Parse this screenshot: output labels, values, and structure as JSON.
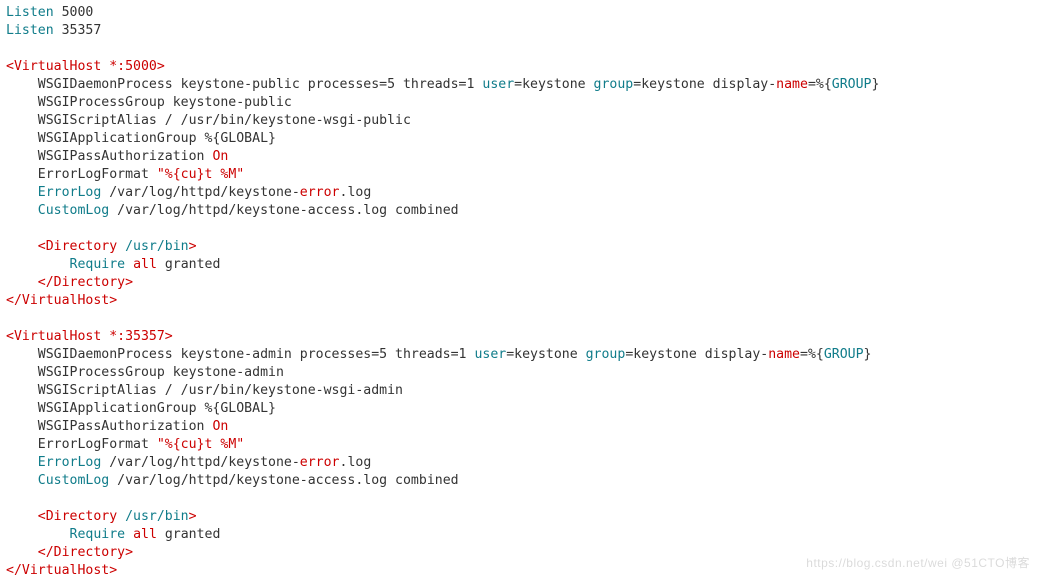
{
  "lines": [
    [
      [
        "kw",
        "Listen"
      ],
      [
        "",
        " 5000"
      ]
    ],
    [
      [
        "kw",
        "Listen"
      ],
      [
        "",
        " 35357"
      ]
    ],
    [
      [
        "",
        ""
      ]
    ],
    [
      [
        "red",
        "<VirtualHost *:5000>"
      ]
    ],
    [
      [
        "",
        "    WSGIDaemonProcess keystone-public processes=5 threads=1 "
      ],
      [
        "kw",
        "user"
      ],
      [
        "",
        "=keystone "
      ],
      [
        "kw",
        "group"
      ],
      [
        "",
        "=keystone display-"
      ],
      [
        "red",
        "name"
      ],
      [
        "",
        "=%{"
      ],
      [
        "grp",
        "GROUP"
      ],
      [
        "",
        "}"
      ]
    ],
    [
      [
        "",
        "    WSGIProcessGroup keystone-public"
      ]
    ],
    [
      [
        "",
        "    WSGIScriptAlias / /usr/bin/keystone-wsgi-public"
      ]
    ],
    [
      [
        "",
        "    WSGIApplicationGroup %{GLOBAL}"
      ]
    ],
    [
      [
        "",
        "    WSGIPassAuthorization "
      ],
      [
        "red",
        "On"
      ]
    ],
    [
      [
        "",
        "    ErrorLogFormat "
      ],
      [
        "red",
        "\"%{cu}t %M\""
      ]
    ],
    [
      [
        "",
        "    "
      ],
      [
        "kw",
        "ErrorLog"
      ],
      [
        "",
        " /var/log/httpd/keystone-"
      ],
      [
        "red",
        "error"
      ],
      [
        "",
        ".log"
      ]
    ],
    [
      [
        "",
        "    "
      ],
      [
        "kw",
        "CustomLog"
      ],
      [
        "",
        " /var/log/httpd/keystone-access.log combined"
      ]
    ],
    [
      [
        "",
        ""
      ]
    ],
    [
      [
        "",
        "    "
      ],
      [
        "red",
        "<Directory "
      ],
      [
        "kw",
        "/usr/bin"
      ],
      [
        "red",
        ">"
      ]
    ],
    [
      [
        "",
        "        "
      ],
      [
        "kw",
        "Require"
      ],
      [
        "",
        " "
      ],
      [
        "red",
        "all"
      ],
      [
        "",
        " granted"
      ]
    ],
    [
      [
        "",
        "    "
      ],
      [
        "red",
        "</Directory>"
      ]
    ],
    [
      [
        "red",
        "</VirtualHost>"
      ]
    ],
    [
      [
        "",
        ""
      ]
    ],
    [
      [
        "red",
        "<VirtualHost *:35357>"
      ]
    ],
    [
      [
        "",
        "    WSGIDaemonProcess keystone-admin processes=5 threads=1 "
      ],
      [
        "kw",
        "user"
      ],
      [
        "",
        "=keystone "
      ],
      [
        "kw",
        "group"
      ],
      [
        "",
        "=keystone display-"
      ],
      [
        "red",
        "name"
      ],
      [
        "",
        "=%{"
      ],
      [
        "grp",
        "GROUP"
      ],
      [
        "",
        "}"
      ]
    ],
    [
      [
        "",
        "    WSGIProcessGroup keystone-admin"
      ]
    ],
    [
      [
        "",
        "    WSGIScriptAlias / /usr/bin/keystone-wsgi-admin"
      ]
    ],
    [
      [
        "",
        "    WSGIApplicationGroup %{GLOBAL}"
      ]
    ],
    [
      [
        "",
        "    WSGIPassAuthorization "
      ],
      [
        "red",
        "On"
      ]
    ],
    [
      [
        "",
        "    ErrorLogFormat "
      ],
      [
        "red",
        "\"%{cu}t %M\""
      ]
    ],
    [
      [
        "",
        "    "
      ],
      [
        "kw",
        "ErrorLog"
      ],
      [
        "",
        " /var/log/httpd/keystone-"
      ],
      [
        "red",
        "error"
      ],
      [
        "",
        ".log"
      ]
    ],
    [
      [
        "",
        "    "
      ],
      [
        "kw",
        "CustomLog"
      ],
      [
        "",
        " /var/log/httpd/keystone-access.log combined"
      ]
    ],
    [
      [
        "",
        ""
      ]
    ],
    [
      [
        "",
        "    "
      ],
      [
        "red",
        "<Directory "
      ],
      [
        "kw",
        "/usr/bin"
      ],
      [
        "red",
        ">"
      ]
    ],
    [
      [
        "",
        "        "
      ],
      [
        "kw",
        "Require"
      ],
      [
        "",
        " "
      ],
      [
        "red",
        "all"
      ],
      [
        "",
        " granted"
      ]
    ],
    [
      [
        "",
        "    "
      ],
      [
        "red",
        "</Directory>"
      ]
    ],
    [
      [
        "red",
        "</VirtualHost>"
      ]
    ]
  ],
  "watermark": "https://blog.csdn.net/wei @51CTO博客"
}
